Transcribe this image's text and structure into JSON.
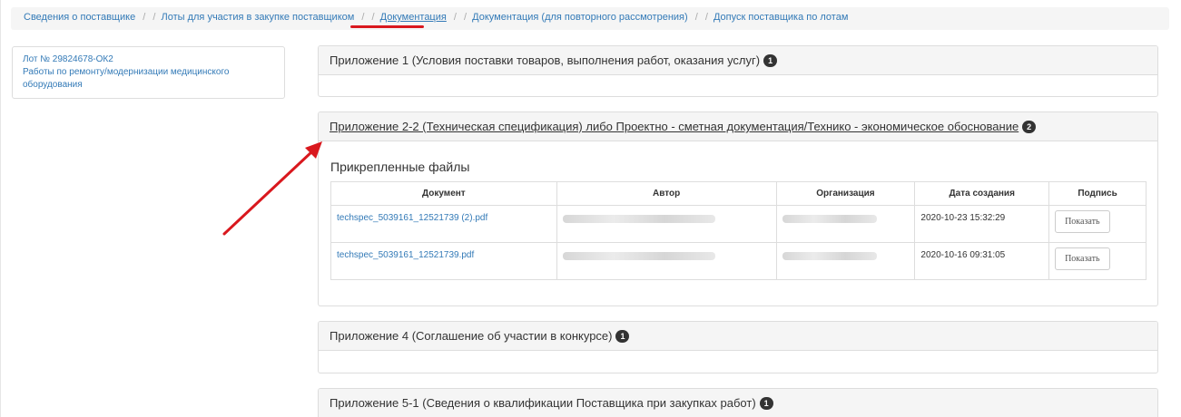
{
  "breadcrumb": {
    "items": [
      {
        "label": "Сведения о поставщике"
      },
      {
        "label": "Лоты для участия в закупке поставщиком"
      },
      {
        "label": "Документация"
      },
      {
        "label": "Документация (для повторного рассмотрения)"
      },
      {
        "label": "Допуск поставщика по лотам"
      }
    ],
    "separator": "/"
  },
  "lot": {
    "number": "Лот № 29824678-ОК2",
    "line1": "Работы по ремонту/модернизации медицинского",
    "line2": "оборудования"
  },
  "panels": [
    {
      "title": "Приложение 1 (Условия поставки товаров, выполнения работ, оказания услуг)",
      "count": "1"
    },
    {
      "title": "Приложение 2-2 (Техническая спецификация) либо Проектно - сметная документация/Технико - экономическое обоснование",
      "count": "2"
    },
    {
      "title": "Приложение 4 (Соглашение об участии в конкурсе)",
      "count": "1"
    },
    {
      "title": "Приложение 5-1 (Сведения о квалификации Поставщика при закупках работ)",
      "count": "1"
    }
  ],
  "files": {
    "title": "Прикрепленные файлы",
    "columns": [
      "Документ",
      "Автор",
      "Организация",
      "Дата создания",
      "Подпись"
    ],
    "rows": [
      {
        "document": "techspec_5039161_12521739 (2).pdf",
        "date": "2020-10-23 15:32:29",
        "button": "Показать"
      },
      {
        "document": "techspec_5039161_12521739.pdf",
        "date": "2020-10-16 09:31:05",
        "button": "Показать"
      }
    ]
  },
  "colors": {
    "link": "#337ab7",
    "annotation": "#d9181e",
    "badge": "#333333"
  }
}
